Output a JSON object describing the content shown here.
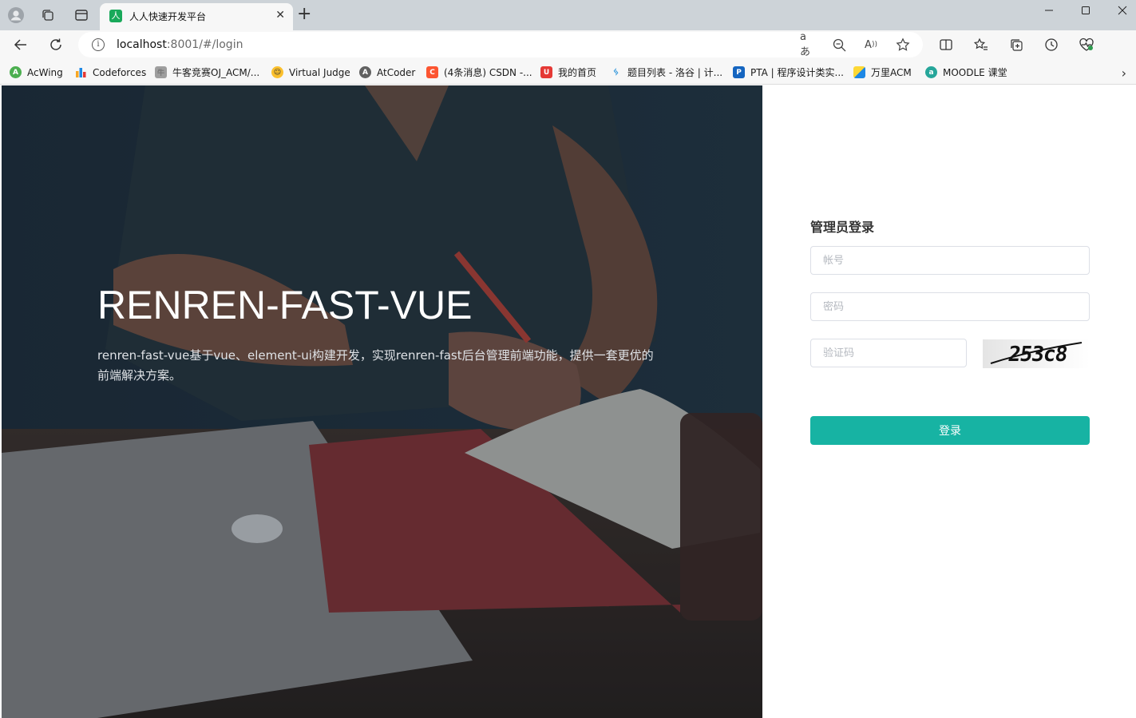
{
  "browser": {
    "tab_title": "人人快速开发平台",
    "tab_favicon": "人",
    "url_host": "localhost",
    "url_path": ":8001/#/login",
    "icons": {
      "profile": "profile-icon",
      "workspaces": "workspaces-icon",
      "vertical_tabs": "vertical-tabs-icon",
      "close_tab": "close-icon",
      "new_tab": "plus-icon",
      "back": "back-arrow-icon",
      "refresh": "refresh-icon",
      "site_info": "info-icon",
      "translate": "translate-icon",
      "zoom_out": "zoom-out-icon",
      "read_aloud": "read-aloud-icon",
      "favorite": "star-icon",
      "split_screen": "split-screen-icon",
      "favorites": "favorites-icon",
      "collections": "collections-icon",
      "history": "history-icon",
      "performance": "heart-pulse-icon"
    },
    "bookmarks": [
      {
        "label": "AcWing",
        "color": "#4caf50"
      },
      {
        "label": "Codeforces",
        "color": "#1e88e5"
      },
      {
        "label": "牛客竞赛OJ_ACM/...",
        "color": "#9e9e9e"
      },
      {
        "label": "Virtual Judge",
        "color": "#fbc02d"
      },
      {
        "label": "AtCoder",
        "color": "#616161"
      },
      {
        "label": "(4条消息) CSDN -...",
        "color": "#fc5531"
      },
      {
        "label": "我的首页",
        "color": "#e53935"
      },
      {
        "label": "题目列表 - 洛谷 | 计...",
        "color": "#3498db"
      },
      {
        "label": "PTA | 程序设计类实...",
        "color": "#1565c0"
      },
      {
        "label": "万里ACM",
        "color": "#fdd835"
      },
      {
        "label": "MOODLE 课堂",
        "color": "#26a69a"
      }
    ]
  },
  "hero": {
    "title": "RENREN-FAST-VUE",
    "description": "renren-fast-vue基于vue、element-ui构建开发，实现renren-fast后台管理前端功能，提供一套更优的前端解决方案。"
  },
  "login": {
    "title": "管理员登录",
    "username_placeholder": "帐号",
    "password_placeholder": "密码",
    "captcha_placeholder": "验证码",
    "captcha_code": "253c8",
    "submit_label": "登录",
    "button_color": "#17b3a3"
  }
}
